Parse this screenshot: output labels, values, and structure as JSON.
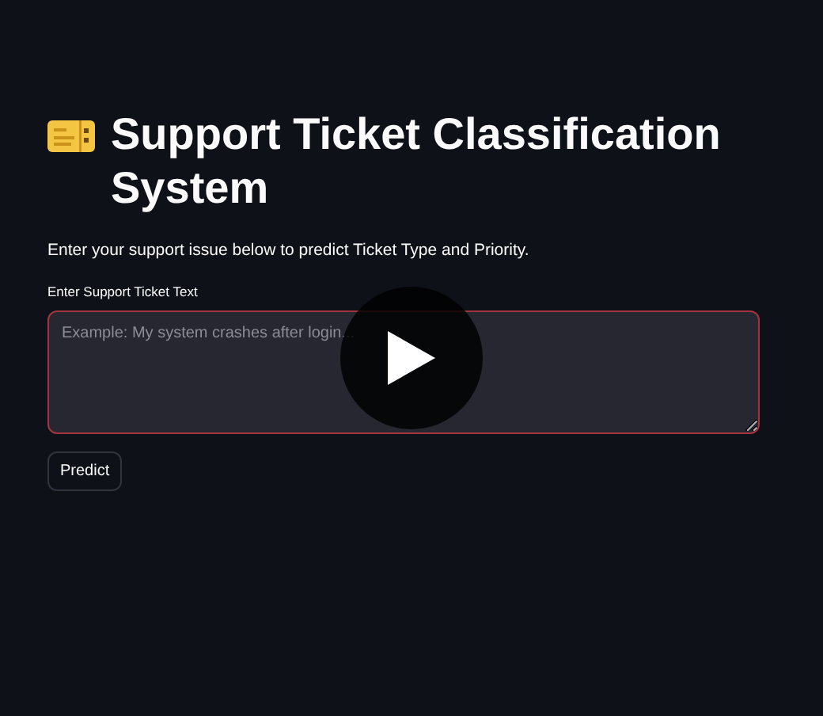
{
  "title": "Support Ticket Classification System",
  "description": "Enter your support issue below to predict Ticket Type and Priority.",
  "ticket_field": {
    "label": "Enter Support Ticket Text",
    "placeholder": "Example: My system crashes after login...",
    "focused": true
  },
  "buttons": [
    {
      "label": "Predict"
    }
  ],
  "video_overlay": {
    "play_button": true
  }
}
